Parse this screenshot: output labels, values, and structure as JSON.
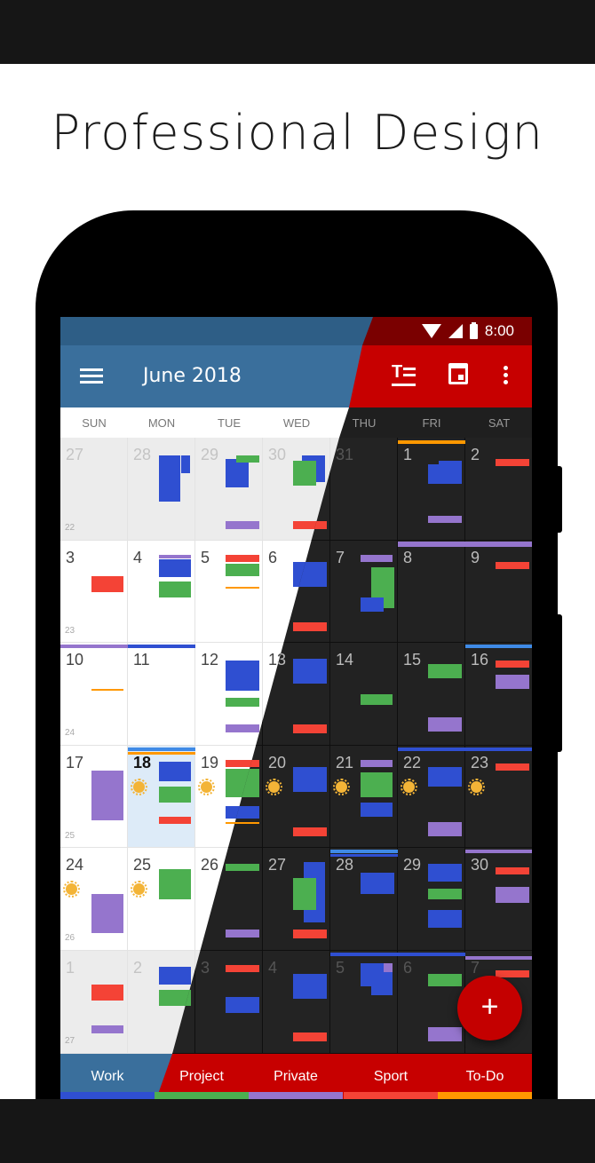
{
  "headline": "Professional Design",
  "status_bar": {
    "time": "8:00"
  },
  "toolbar": {
    "title": "June 2018"
  },
  "weekdays": [
    "SUN",
    "MON",
    "TUE",
    "WED",
    "THU",
    "FRI",
    "SAT"
  ],
  "weeks": [
    {
      "number": "22",
      "days": [
        "27",
        "28",
        "29",
        "30",
        "31",
        "1",
        "2"
      ]
    },
    {
      "number": "23",
      "days": [
        "3",
        "4",
        "5",
        "6",
        "7",
        "8",
        "9"
      ]
    },
    {
      "number": "24",
      "days": [
        "10",
        "11",
        "12",
        "13",
        "14",
        "15",
        "16"
      ]
    },
    {
      "number": "25",
      "days": [
        "17",
        "18",
        "19",
        "20",
        "21",
        "22",
        "23"
      ]
    },
    {
      "number": "26",
      "days": [
        "24",
        "25",
        "26",
        "27",
        "28",
        "29",
        "30"
      ]
    },
    {
      "number": "27",
      "days": [
        "1",
        "2",
        "3",
        "4",
        "5",
        "6",
        "7"
      ]
    }
  ],
  "today": "18",
  "tabs": [
    {
      "label": "Work",
      "color": "#2f4fd1"
    },
    {
      "label": "Project",
      "color": "#4caf50"
    },
    {
      "label": "Private",
      "color": "#9575cd"
    },
    {
      "label": "Sport",
      "color": "#f44336"
    },
    {
      "label": "To-Do",
      "color": "#ff9800"
    }
  ],
  "category_colors": {
    "work": "#2f4fd1",
    "project": "#4caf50",
    "private": "#9575cd",
    "sport": "#f44336",
    "todo": "#ff9800",
    "light_blue": "#3f8ae6"
  },
  "fab": {
    "label": "+"
  }
}
